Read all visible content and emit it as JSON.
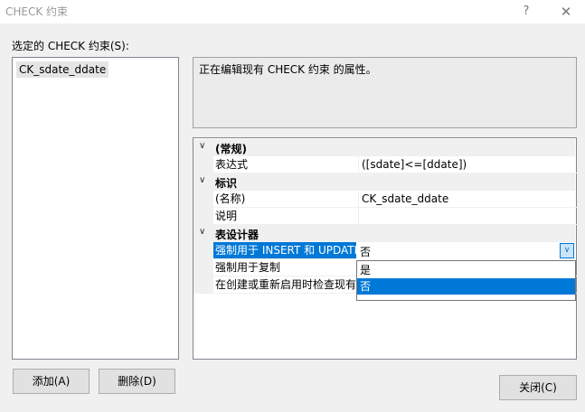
{
  "window": {
    "title": "CHECK 约束",
    "help": "?",
    "close": "✕"
  },
  "list": {
    "label": "选定的 CHECK 约束(S):",
    "items": [
      "CK_sdate_ddate"
    ]
  },
  "description": "正在编辑现有 CHECK 约束 的属性。",
  "grid": {
    "general": {
      "title": "(常规)",
      "expression_label": "表达式",
      "expression_value": "([sdate]<=[ddate])"
    },
    "identity": {
      "title": "标识",
      "name_label": "(名称)",
      "name_value": "CK_sdate_ddate",
      "desc_label": "说明",
      "desc_value": ""
    },
    "designer": {
      "title": "表设计器",
      "enforce_insert_label": "强制用于 INSERT 和 UPDATE",
      "enforce_insert_value": "否",
      "enforce_repl_label": "强制用于复制",
      "check_existing_label": "在创建或重新启用时检查现有数据"
    }
  },
  "dropdown": {
    "options": [
      "是",
      "否"
    ],
    "selected": "否"
  },
  "buttons": {
    "add": "添加(A)",
    "delete": "删除(D)",
    "close": "关闭(C)"
  }
}
